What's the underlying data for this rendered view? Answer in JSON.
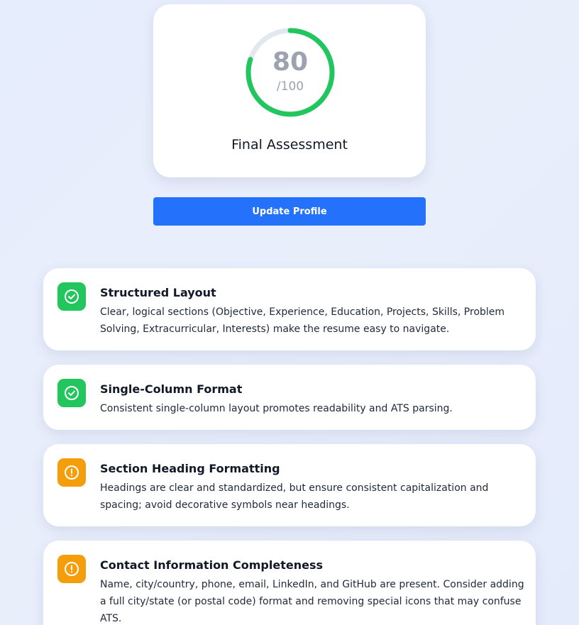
{
  "score": {
    "value": "80",
    "max_label": "/100",
    "fraction": 0.8,
    "title": "Final Assessment",
    "ring_color": "#22c55e",
    "track_color": "#e2e8f0"
  },
  "update_button": {
    "label": "Update Profile",
    "color": "#2472fb"
  },
  "feedback": [
    {
      "status": "good",
      "icon": "check-circle-icon",
      "title": "Structured Layout",
      "description": "Clear, logical sections (Objective, Experience, Education, Projects, Skills, Problem Solving, Extracurricular, Interests) make the resume easy to navigate."
    },
    {
      "status": "good",
      "icon": "check-circle-icon",
      "title": "Single-Column Format",
      "description": "Consistent single-column layout promotes readability and ATS parsing."
    },
    {
      "status": "warn",
      "icon": "alert-circle-icon",
      "title": "Section Heading Formatting",
      "description": "Headings are clear and standardized, but ensure consistent capitalization and spacing; avoid decorative symbols near headings."
    },
    {
      "status": "warn",
      "icon": "alert-circle-icon",
      "title": "Contact Information Completeness",
      "description": "Name, city/country, phone, email, LinkedIn, and GitHub are present. Consider adding a full city/state (or postal code) format and removing special icons that may confuse ATS."
    }
  ],
  "colors": {
    "good": "#22c55e",
    "warn": "#f59e0b"
  }
}
